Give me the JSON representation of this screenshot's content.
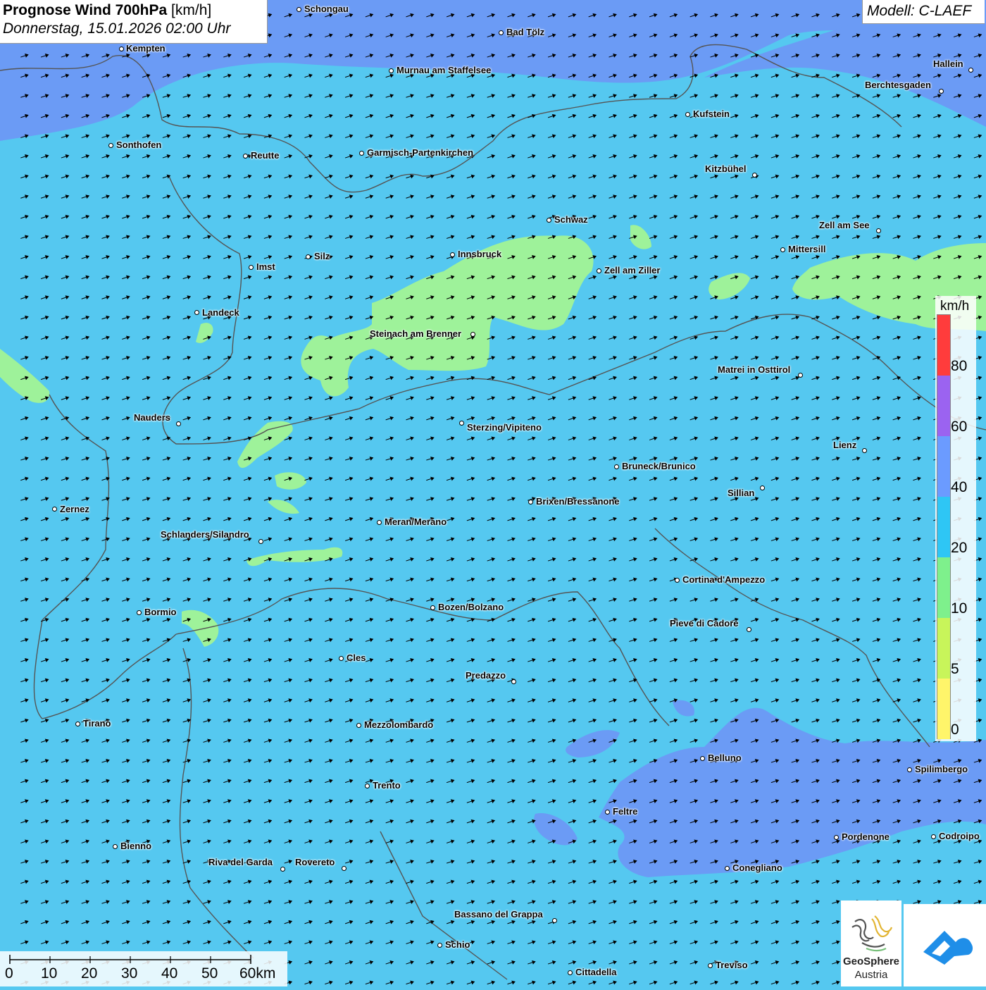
{
  "header": {
    "title_bold": "Prognose Wind 700hPa",
    "title_unit": " [km/h]",
    "datetime": "Donnerstag, 15.01.2026 02:00 Uhr",
    "model": "Modell: C-LAEF"
  },
  "legend": {
    "unit": "km/h",
    "labels": [
      "80",
      "60",
      "40",
      "20",
      "10",
      "5",
      "0"
    ],
    "colors": [
      "#ff3c3c",
      "#9b63f0",
      "#6b9bff",
      "#2ec6f5",
      "#7ef08c",
      "#c8f55a",
      "#fff56a"
    ]
  },
  "scale": {
    "labels": [
      "0",
      "10",
      "20",
      "30",
      "40",
      "50",
      "60km"
    ]
  },
  "logo": {
    "name_line1": "GeoSphere",
    "name_line2": "Austria",
    "icon": "geosphere-logo-icon",
    "app_icon": "warning-app-cloud-icon"
  },
  "colors": {
    "wind_10_20": "#55c8f0",
    "wind_5_10": "#9ef29a",
    "wind_20_40": "#6aa0f8",
    "wind_above_40": "#6f90f4",
    "border_line": "#555555",
    "arrow": "#000000"
  },
  "cities": [
    "Schongau",
    "Bad Tölz",
    "Kempten",
    "Murnau am Staffelsee",
    "Hallein",
    "Berchtesgaden",
    "Kufstein",
    "Sonthofen",
    "Reutte",
    "Garmisch-Partenkirchen",
    "Kitzbühel",
    "Schwaz",
    "Zell am See",
    "Mittersill",
    "Innsbruck",
    "Silz",
    "Imst",
    "Zell am Ziller",
    "Landeck",
    "Steinach am Brenner",
    "Matrei in Osttirol",
    "Nauders",
    "Sterzing/Vipiteno",
    "Lienz",
    "Bruneck/Brunico",
    "Sillian",
    "Zernez",
    "Brixen/Bressanone",
    "Meran/Merano",
    "Schlanders/Silandro",
    "Cortina d'Ampezzo",
    "Bozen/Bolzano",
    "Bormio",
    "Pieve di Cadore",
    "Cles",
    "Predazzo",
    "Tirano",
    "Mezzolombardo",
    "Belluno",
    "Spilimbergo",
    "Trento",
    "Feltre",
    "Pordenone",
    "Codroipo",
    "Bienno",
    "Riva del Garda",
    "Rovereto",
    "Conegliano",
    "Bassano del Grappa",
    "Schio",
    "Treviso",
    "Cittadella"
  ]
}
